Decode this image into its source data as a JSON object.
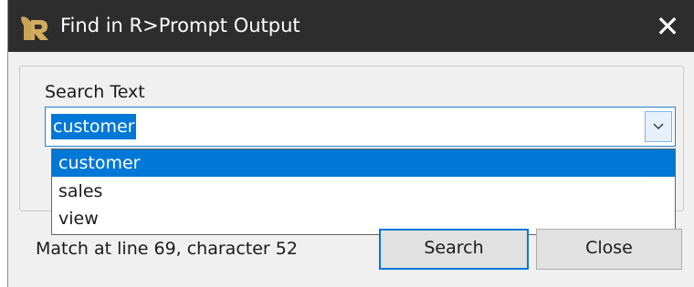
{
  "window": {
    "title": "Find in R>Prompt Output",
    "app_icon": "r-logo-icon",
    "close_icon": "close-icon",
    "close_glyph": "✕"
  },
  "search": {
    "label": "Search Text",
    "value": "customer",
    "dropdown_icon": "chevron-down-icon",
    "options": [
      "customer",
      "sales",
      "view"
    ],
    "selected_option": "customer"
  },
  "status_text": "Match at line 69, character 52",
  "buttons": {
    "search_label": "Search",
    "close_label": "Close"
  },
  "colors": {
    "titlebar": "#2d2d2d",
    "selection": "#0078d7",
    "focus_border": "#0078d7"
  }
}
